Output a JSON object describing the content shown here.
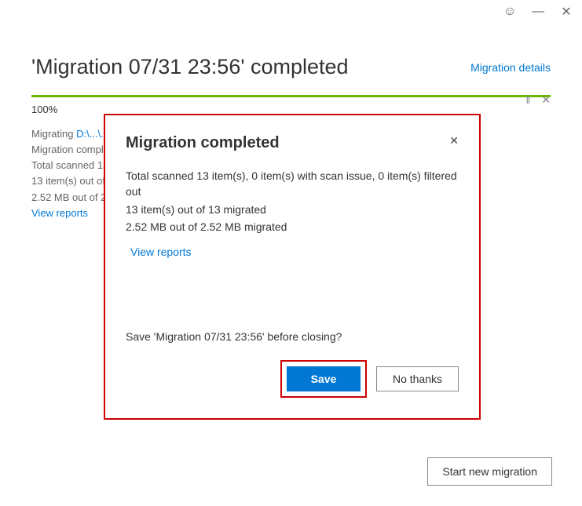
{
  "titlebar": {
    "smile": "☺",
    "minimize": "—",
    "close": "✕"
  },
  "header": {
    "title": "'Migration 07/31 23:56' completed",
    "details_link": "Migration details"
  },
  "progress": {
    "percent": "100%",
    "pause": "‖",
    "close": "✕"
  },
  "status": {
    "migrating_label": "Migrating",
    "path": "D:\\...\\..",
    "line1": "Migration completed",
    "line2": "Total scanned 13",
    "line3": "13 item(s) out of",
    "line4": "2.52 MB out of 2.",
    "view_reports": "View reports"
  },
  "dialog": {
    "title": "Migration completed",
    "close": "✕",
    "body_line1": "Total scanned 13 item(s), 0 item(s) with scan issue, 0 item(s) filtered out",
    "body_line2": "13 item(s) out of 13 migrated",
    "body_line3": "2.52 MB out of 2.52 MB migrated",
    "view_reports": "View reports",
    "question": "Save 'Migration 07/31 23:56' before closing?",
    "save": "Save",
    "no_thanks": "No thanks"
  },
  "footer": {
    "start_new": "Start new migration"
  }
}
